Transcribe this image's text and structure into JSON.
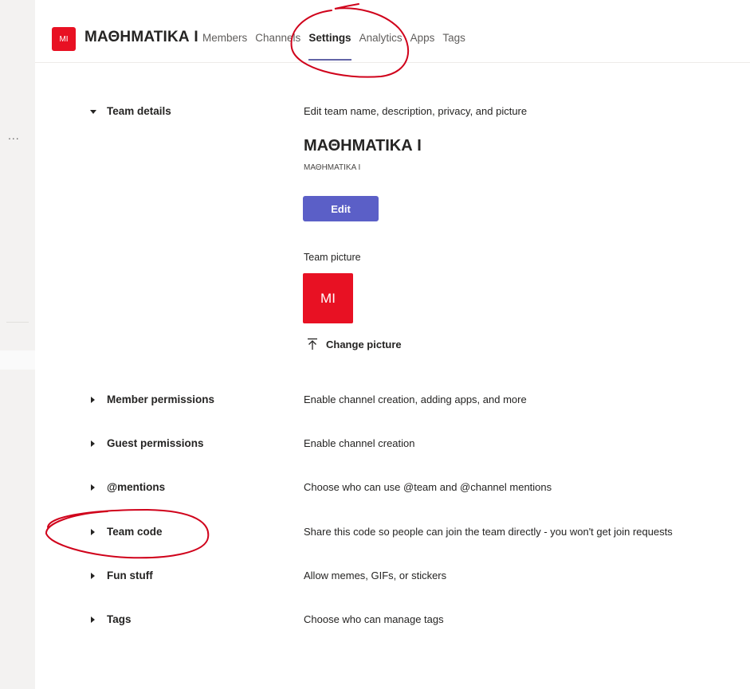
{
  "header": {
    "team_initials": "MI",
    "team_name": "ΜΑΘΗΜΑΤΙΚΑ Ι",
    "tabs": [
      {
        "label": "Members"
      },
      {
        "label": "Channels"
      },
      {
        "label": "Settings",
        "active": true
      },
      {
        "label": "Analytics"
      },
      {
        "label": "Apps"
      },
      {
        "label": "Tags"
      }
    ]
  },
  "rail": {
    "more_glyph": "..."
  },
  "sections": [
    {
      "label": "Team details",
      "description": "Edit team name, description, privacy, and picture",
      "expanded": true
    },
    {
      "label": "Member permissions",
      "description": "Enable channel creation, adding apps, and more"
    },
    {
      "label": "Guest permissions",
      "description": "Enable channel creation"
    },
    {
      "label": "@mentions",
      "description": "Choose who can use @team and @channel mentions"
    },
    {
      "label": "Team code",
      "description": "Share this code so people can join the team directly - you won't get join requests"
    },
    {
      "label": "Fun stuff",
      "description": "Allow memes, GIFs, or stickers"
    },
    {
      "label": "Tags",
      "description": "Choose who can manage tags"
    }
  ],
  "team_details": {
    "name": "ΜΑΘΗΜΑΤΙΚΑ Ι",
    "description": "ΜΑΘΗΜΑΤΙΚΑ Ι",
    "edit_label": "Edit",
    "picture_label": "Team picture",
    "picture_initials": "MI",
    "change_picture_label": "Change picture"
  },
  "colors": {
    "accent": "#5b5fc7",
    "team_avatar": "#e81123",
    "annotation": "#d0021b"
  }
}
